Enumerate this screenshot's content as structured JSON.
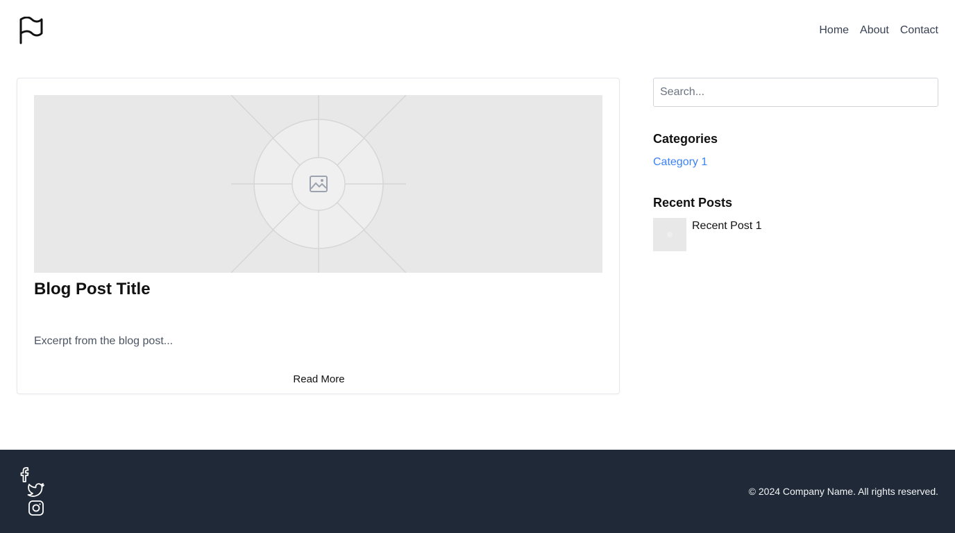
{
  "nav": {
    "logo_icon": "flag-icon",
    "links": [
      "Home",
      "About",
      "Contact"
    ]
  },
  "post": {
    "image_icon": "image-placeholder-icon",
    "title": "Blog Post Title",
    "excerpt": "Excerpt from the blog post...",
    "read_more_label": "Read More"
  },
  "sidebar": {
    "search_placeholder": "Search...",
    "categories_heading": "Categories",
    "categories": [
      "Category 1"
    ],
    "recent_heading": "Recent Posts",
    "recent_posts": [
      "Recent Post 1"
    ]
  },
  "footer": {
    "social_icons": [
      "facebook-icon",
      "twitter-icon",
      "instagram-icon"
    ],
    "copyright": "© 2024 Company Name. All rights reserved."
  },
  "colors": {
    "footer_bg": "#1f2937",
    "link_accent": "#3b82f6",
    "placeholder_bg": "#e8e8e8"
  }
}
